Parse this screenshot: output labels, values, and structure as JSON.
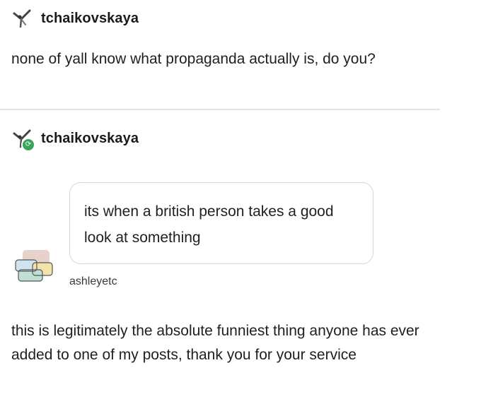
{
  "original_post": {
    "username": "tchaikovskaya",
    "text": "none of yall know what propaganda actually is, do you?"
  },
  "reblog": {
    "username": "tchaikovskaya",
    "reblog_icon": "reblog-icon",
    "ask": {
      "question": "its when a british person takes a good look at something",
      "asker": "ashleyetc"
    },
    "answer": "this is legitimately the absolute funniest thing anyone has ever added to one of my posts, thank you for your service"
  },
  "colors": {
    "reblog_badge": "#3ca35b",
    "divider": "#e4e4e4",
    "bubble_border": "#d6d6d6"
  }
}
